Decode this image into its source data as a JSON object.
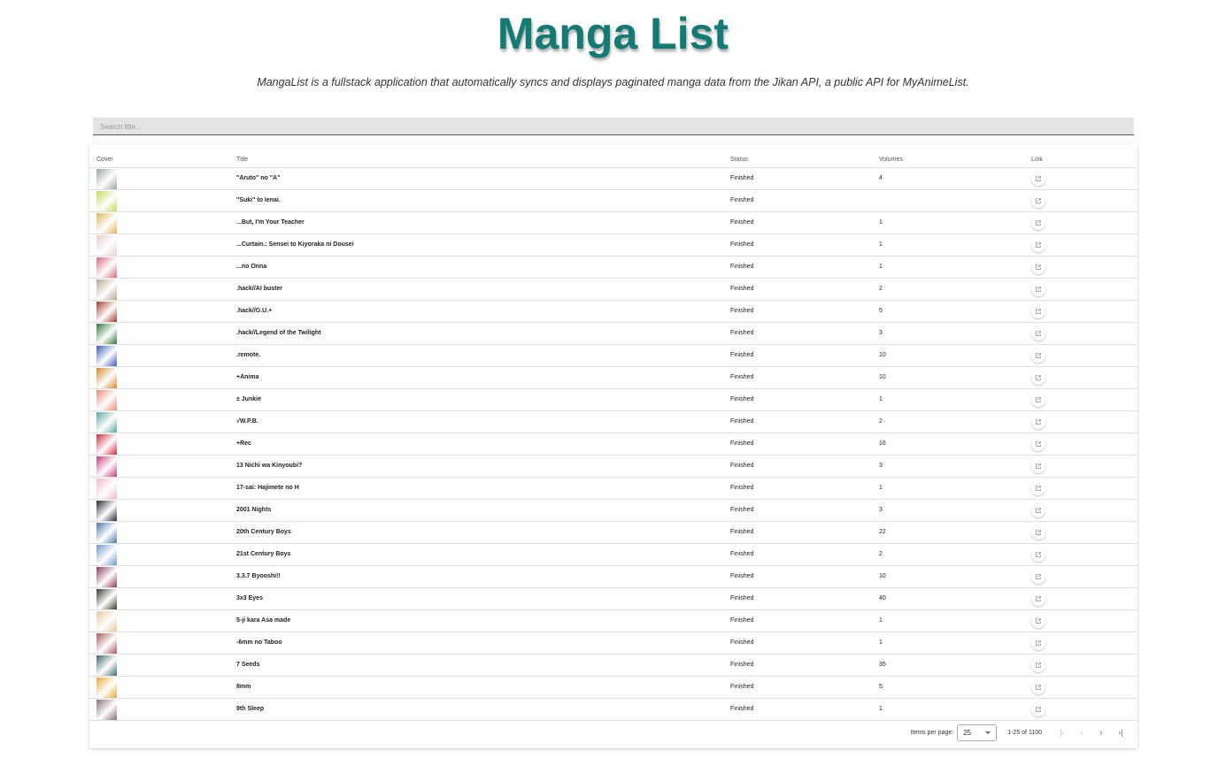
{
  "header": {
    "title": "Manga List",
    "subtitle": "MangaList is a fullstack application that automatically syncs and displays paginated manga data from the Jikan API, a public API for MyAnimeList."
  },
  "search": {
    "placeholder": "Search title..."
  },
  "table": {
    "columns": [
      "Cover",
      "Title",
      "Status",
      "Volumes",
      "Link"
    ],
    "rows": [
      {
        "title": "\"Aruto\" no \"A\"",
        "status": "Finished",
        "volumes": "4",
        "cover_color": "#9aa6a8"
      },
      {
        "title": "\"Suki\" to Ienai.",
        "status": "Finished",
        "volumes": "",
        "cover_color": "#c8d858"
      },
      {
        "title": "...But, I'm Your Teacher",
        "status": "Finished",
        "volumes": "1",
        "cover_color": "#e2b45a"
      },
      {
        "title": "...Curtain.: Sensei to Kiyoraka ni Dousei",
        "status": "Finished",
        "volumes": "1",
        "cover_color": "#e8d0cc"
      },
      {
        "title": "...no Onna",
        "status": "Finished",
        "volumes": "1",
        "cover_color": "#d86a7a"
      },
      {
        "title": ".hack//AI buster",
        "status": "Finished",
        "volumes": "2",
        "cover_color": "#b8a690"
      },
      {
        "title": ".hack//G.U.+",
        "status": "Finished",
        "volumes": "5",
        "cover_color": "#a83a28"
      },
      {
        "title": ".hack//Legend of the Twilight",
        "status": "Finished",
        "volumes": "3",
        "cover_color": "#2e7a36"
      },
      {
        "title": ".remote.",
        "status": "Finished",
        "volumes": "10",
        "cover_color": "#3a5ab8"
      },
      {
        "title": "+Anima",
        "status": "Finished",
        "volumes": "10",
        "cover_color": "#d6882e"
      },
      {
        "title": "± Junkie",
        "status": "Finished",
        "volumes": "1",
        "cover_color": "#e88a76"
      },
      {
        "title": "√W.P.B.",
        "status": "Finished",
        "volumes": "2",
        "cover_color": "#58a8a0"
      },
      {
        "title": "+Rec",
        "status": "Finished",
        "volumes": "16",
        "cover_color": "#d42a3a"
      },
      {
        "title": "13 Nichi wa Kinyoubi?",
        "status": "Finished",
        "volumes": "3",
        "cover_color": "#c43a7a"
      },
      {
        "title": "17-sai: Hajimete no H",
        "status": "Finished",
        "volumes": "1",
        "cover_color": "#f0b8c8"
      },
      {
        "title": "2001 Nights",
        "status": "Finished",
        "volumes": "3",
        "cover_color": "#2a2a3a"
      },
      {
        "title": "20th Century Boys",
        "status": "Finished",
        "volumes": "22",
        "cover_color": "#4a7aa8"
      },
      {
        "title": "21st Century Boys",
        "status": "Finished",
        "volumes": "2",
        "cover_color": "#6a9ac8"
      },
      {
        "title": "3.3.7 Byooshi!!",
        "status": "Finished",
        "volumes": "10",
        "cover_color": "#8a3a5a"
      },
      {
        "title": "3x3 Eyes",
        "status": "Finished",
        "volumes": "40",
        "cover_color": "#3a3a2a"
      },
      {
        "title": "5-ji kara Asa made",
        "status": "Finished",
        "volumes": "1",
        "cover_color": "#e8c898"
      },
      {
        "title": "-6mm no Taboo",
        "status": "Finished",
        "volumes": "1",
        "cover_color": "#a85a58"
      },
      {
        "title": "7 Seeds",
        "status": "Finished",
        "volumes": "35",
        "cover_color": "#3a6a68"
      },
      {
        "title": "8mm",
        "status": "Finished",
        "volumes": "5",
        "cover_color": "#e8a838"
      },
      {
        "title": "9th Sleep",
        "status": "Finished",
        "volumes": "1",
        "cover_color": "#8a6a7a"
      }
    ]
  },
  "paginator": {
    "items_per_page_label": "Items per page:",
    "items_per_page": "25",
    "range_label": "1-25 of 1100",
    "first_icon": "first-page-icon",
    "prev_icon": "chevron-left-icon",
    "next_icon": "chevron-right-icon",
    "last_icon": "last-page-icon"
  },
  "colors": {
    "accent": "#137a74"
  }
}
